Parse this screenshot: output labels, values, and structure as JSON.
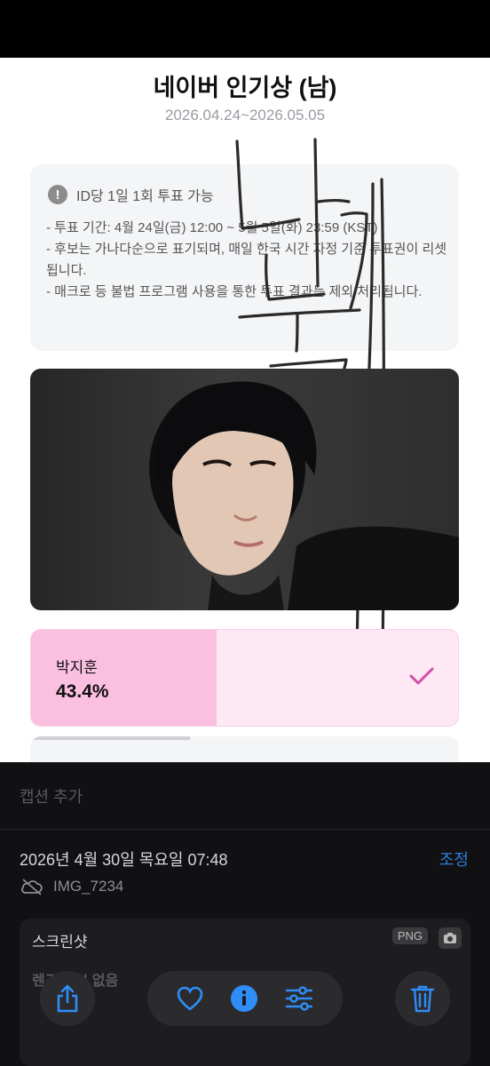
{
  "page": {
    "title": "네이버 인기상 (남)",
    "period": "2026.04.24~2026.05.05"
  },
  "notice": {
    "headline": "ID당 1일 1회 투표 가능",
    "lines": [
      "- 투표 기간: 4월 24일(금) 12:00 ~ 5월 5일(화) 23:59 (KST)",
      "- 후보는 가나다순으로 표기되며, 매일 한국 시간 자정 기준 투표권이 리셋됩니다.",
      "- 매크로 등 불법 프로그램 사용을 통한 투표 결과는 제외 처리됩니다."
    ]
  },
  "handwriting": "나 눌게",
  "candidate": {
    "name": "박지훈",
    "percent_label": "43.4%",
    "vote_share": 0.434,
    "selected": true
  },
  "photo_info": {
    "caption_placeholder": "캡션 추가",
    "datetime": "2026년 4월 30일 목요일 07:48",
    "adjust_label": "조정",
    "file_name": "IMG_7234",
    "type_label": "스크린샷",
    "format_badge": "PNG",
    "lens_text": "렌즈 정보 없음"
  },
  "toolbar": {
    "share": "share-icon",
    "favorite": "heart-icon",
    "info": "info-icon",
    "edit": "sliders-icon",
    "delete": "trash-icon"
  },
  "colors": {
    "vote_fill": "#fbbfe0",
    "vote_bg": "#fde8f4",
    "check": "#d44fa8",
    "accent_blue": "#2f7de0"
  }
}
